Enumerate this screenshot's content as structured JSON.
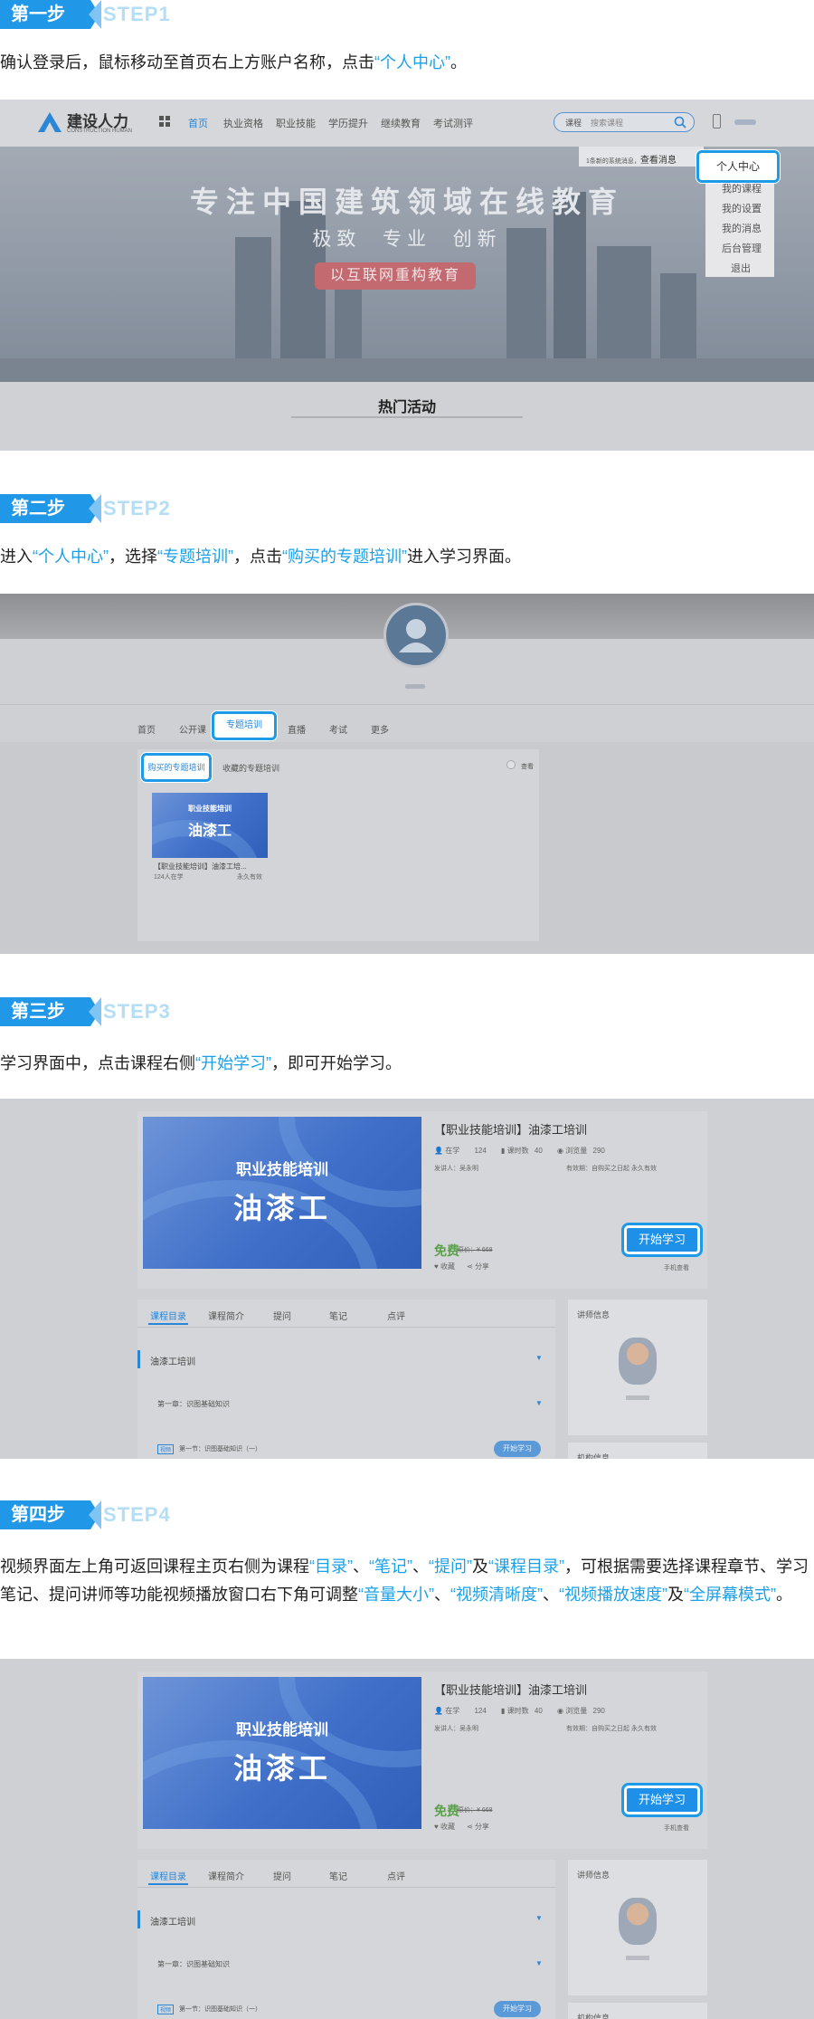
{
  "steps": [
    {
      "label": "第一步",
      "en": "STEP1"
    },
    {
      "label": "第二步",
      "en": "STEP2"
    },
    {
      "label": "第三步",
      "en": "STEP3"
    },
    {
      "label": "第四步",
      "en": "STEP4"
    }
  ],
  "instructions": {
    "s1_a": "确认登录后，鼠标移动至首页右上方账户名称，点击",
    "s1_hl": "“个人中心”",
    "s1_b": "。",
    "s2_a": "进入",
    "s2_hl1": "“个人中心”",
    "s2_b": "，选择",
    "s2_hl2": "“专题培训”",
    "s2_c": "，点击",
    "s2_hl3": "“购买的专题培训”",
    "s2_d": "进入学习界面。",
    "s3_a": "学习界面中，点击课程右侧",
    "s3_hl": "“开始学习”",
    "s3_b": "，即可开始学习。",
    "s4_a": "视频界面左上角可返回课程主页右侧为课程",
    "s4_hl1": "“目录”",
    "s4_sep1": "、",
    "s4_hl2": "“笔记”",
    "s4_sep2": "、",
    "s4_hl3": "“提问”",
    "s4_b": "及",
    "s4_hl4": "“课程目录”",
    "s4_c": "，可根据需要选择课程章节、学习笔记、提问讲师等功能视频播放窗口右下角可调整",
    "s4_hl5": "“音量大小”",
    "s4_sep3": "、",
    "s4_hl6": "“视频清晰度”",
    "s4_sep4": "、",
    "s4_hl7": "“视频播放速度”",
    "s4_d": "及",
    "s4_hl8": "“全屏幕模式”",
    "s4_e": "。"
  },
  "shot1": {
    "logo_text": "建设人力",
    "logo_sub": "CONSTRUCTION HUMAN",
    "nav": [
      "首页",
      "执业资格",
      "职业技能",
      "学历提升",
      "继续教育",
      "考试测评"
    ],
    "search_scope": "课程",
    "search_placeholder": "搜索课程",
    "notice": "1条新的系统消息，",
    "notice_link": "查看消息",
    "personal_center": "个人中心",
    "menu": [
      "我的课程",
      "我的设置",
      "我的消息",
      "后台管理",
      "退出"
    ],
    "banner_title": "专注中国建筑领域在线教育",
    "banner_sub": "极致  专业  创新",
    "banner_btn": "以互联网重构教育",
    "hot_title": "热门活动"
  },
  "shot2": {
    "tabs": [
      "首页",
      "公开课",
      "专题培训",
      "直播",
      "考试",
      "更多"
    ],
    "subtabs": [
      "购买的专题培训",
      "收藏的专题培训"
    ],
    "subtab_right": "查看",
    "card_tag": "职业技能培训",
    "card_big": "油漆工",
    "card_title": "【职业技能培训】油漆工培...",
    "card_meta_left": "124人在学",
    "card_meta_right": "永久有效"
  },
  "course": {
    "thumb_small": "职业技能培训",
    "thumb_big": "油漆工",
    "title": "【职业技能培训】油漆工培训",
    "meta_learning": "在学",
    "meta_learning_n": "124",
    "meta_hours": "课时数",
    "meta_hours_n": "40",
    "meta_views": "浏览量",
    "meta_views_n": "290",
    "leader": "发讲人：吴永明",
    "validity": "有效期：自购买之日起 永久有效",
    "price": "免费",
    "orig_price": "原价：¥ 668",
    "fav": "收藏",
    "share": "分享",
    "mobile": "手机查看",
    "start_btn": "开始学习",
    "tabs": [
      "课程目录",
      "课程简介",
      "提问",
      "笔记",
      "点评"
    ],
    "section": "油漆工培训",
    "chapter": "第一章：识图基础知识",
    "lesson_tag": "视频",
    "lesson": "第一节：识图基础知识（一）",
    "lesson_btn": "开始学习",
    "side_teacher": "讲师信息",
    "side_org": "机构信息"
  }
}
